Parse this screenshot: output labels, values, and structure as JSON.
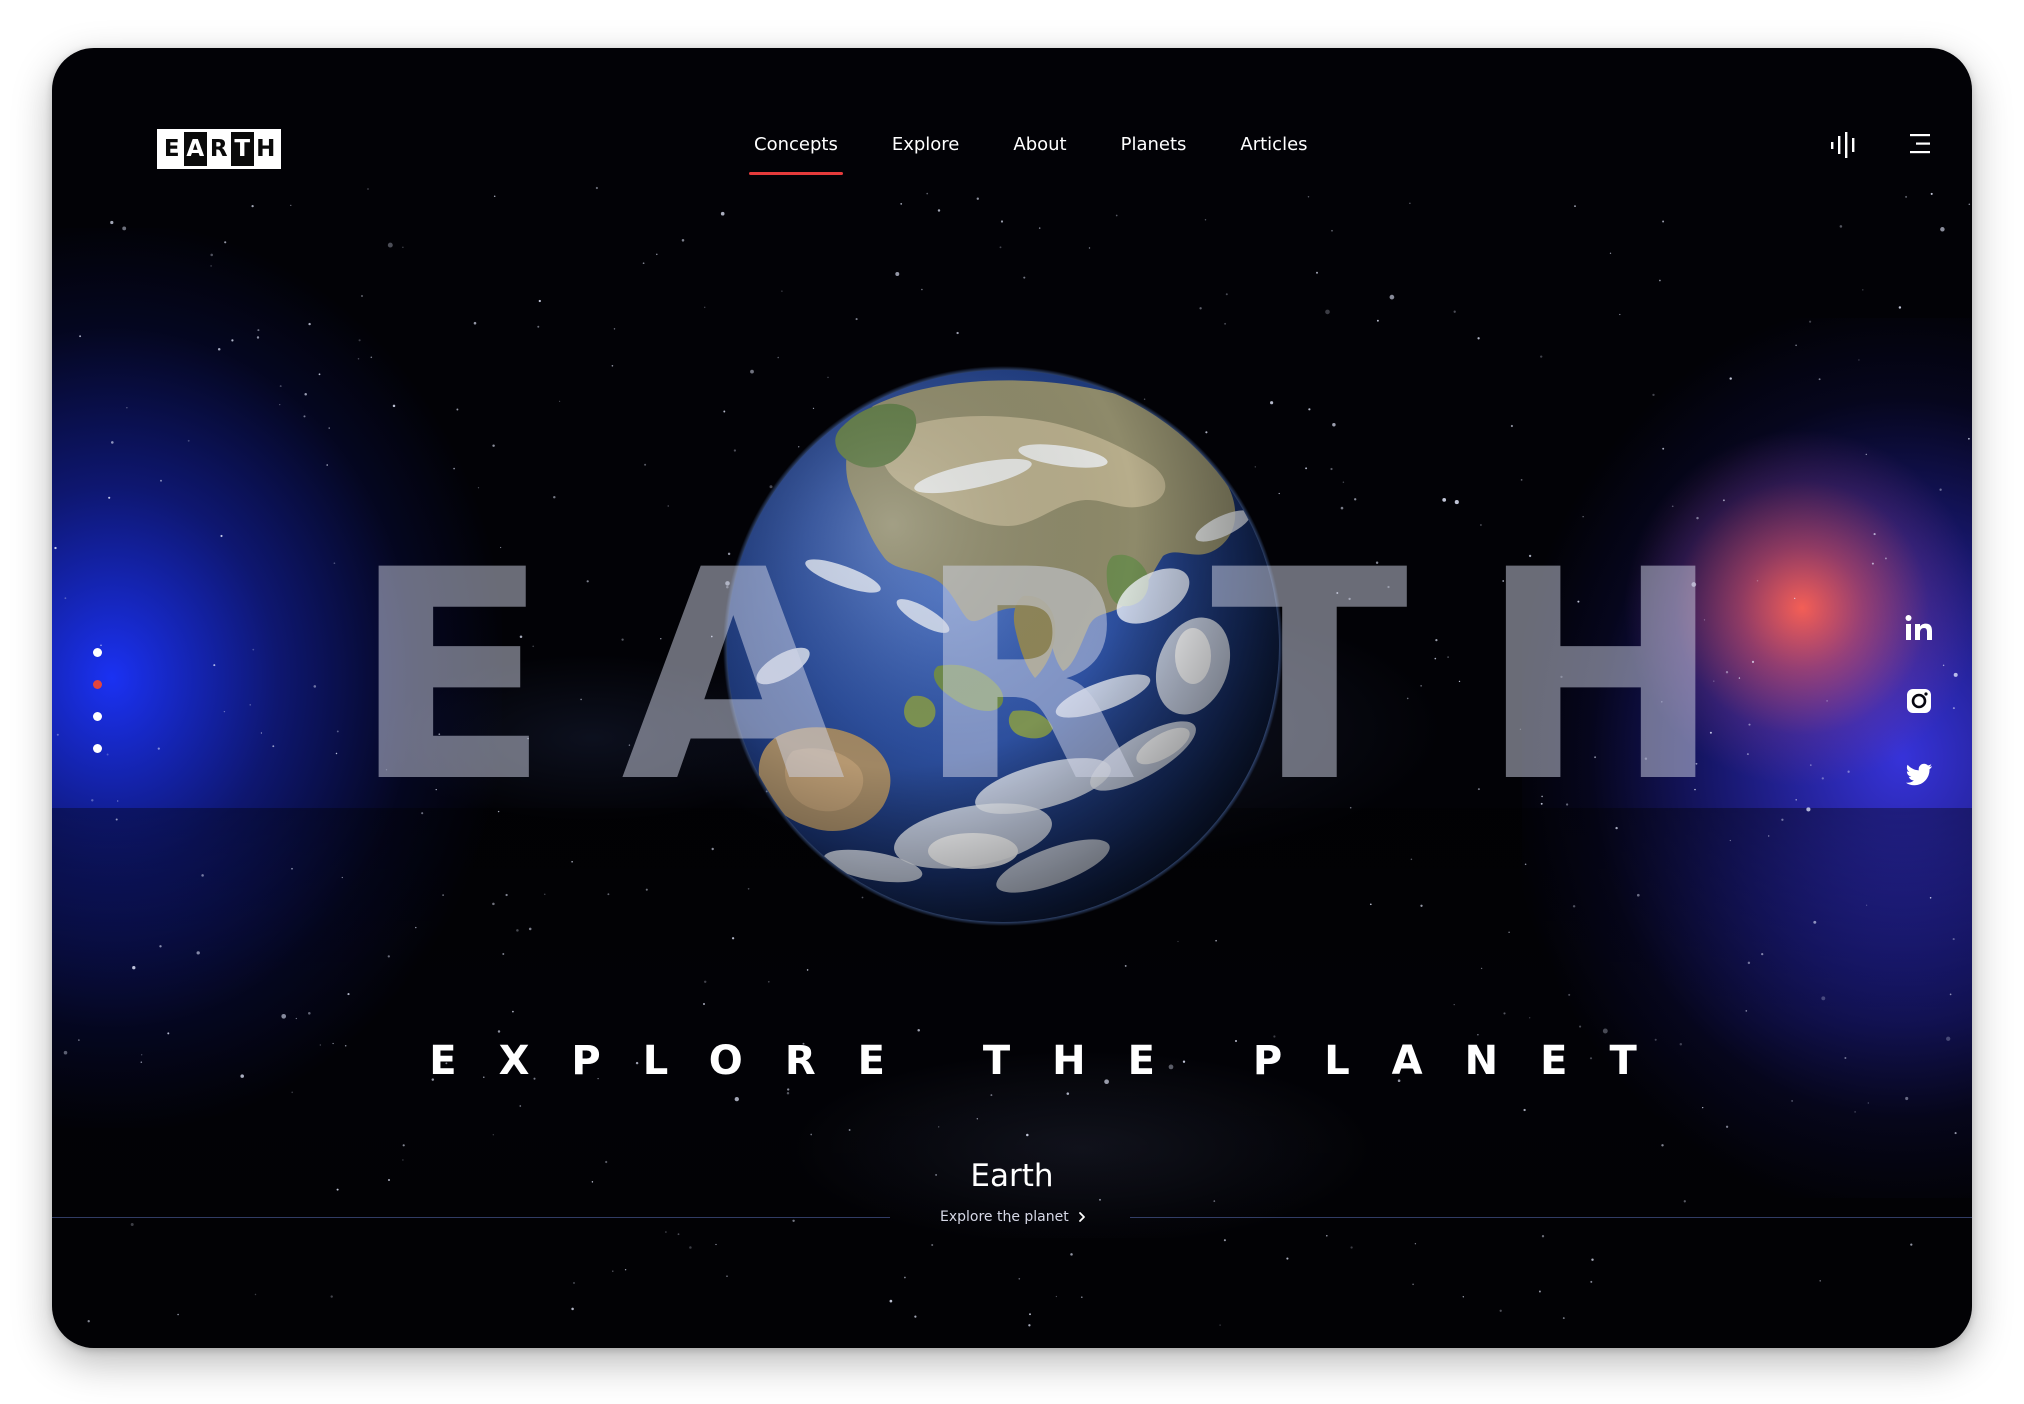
{
  "brand": {
    "logo_letters": [
      "E",
      "A",
      "R",
      "T",
      "H"
    ],
    "accent_color": "#e53b3b"
  },
  "nav": {
    "items": [
      {
        "label": "Concepts",
        "active": true
      },
      {
        "label": "Explore",
        "active": false
      },
      {
        "label": "About",
        "active": false
      },
      {
        "label": "Planets",
        "active": false
      },
      {
        "label": "Articles",
        "active": false
      }
    ]
  },
  "header_icons": [
    "audio-bars-icon",
    "menu-icon"
  ],
  "hero": {
    "big_letters": [
      "E",
      "A",
      "R",
      "T",
      "H"
    ],
    "tagline": "EXPLORE THE PLANET",
    "caption_title": "Earth",
    "caption_link": "Explore the planet"
  },
  "slides": {
    "count": 4,
    "active_index": 1
  },
  "social": [
    "linkedin-icon",
    "instagram-icon",
    "twitter-icon"
  ]
}
